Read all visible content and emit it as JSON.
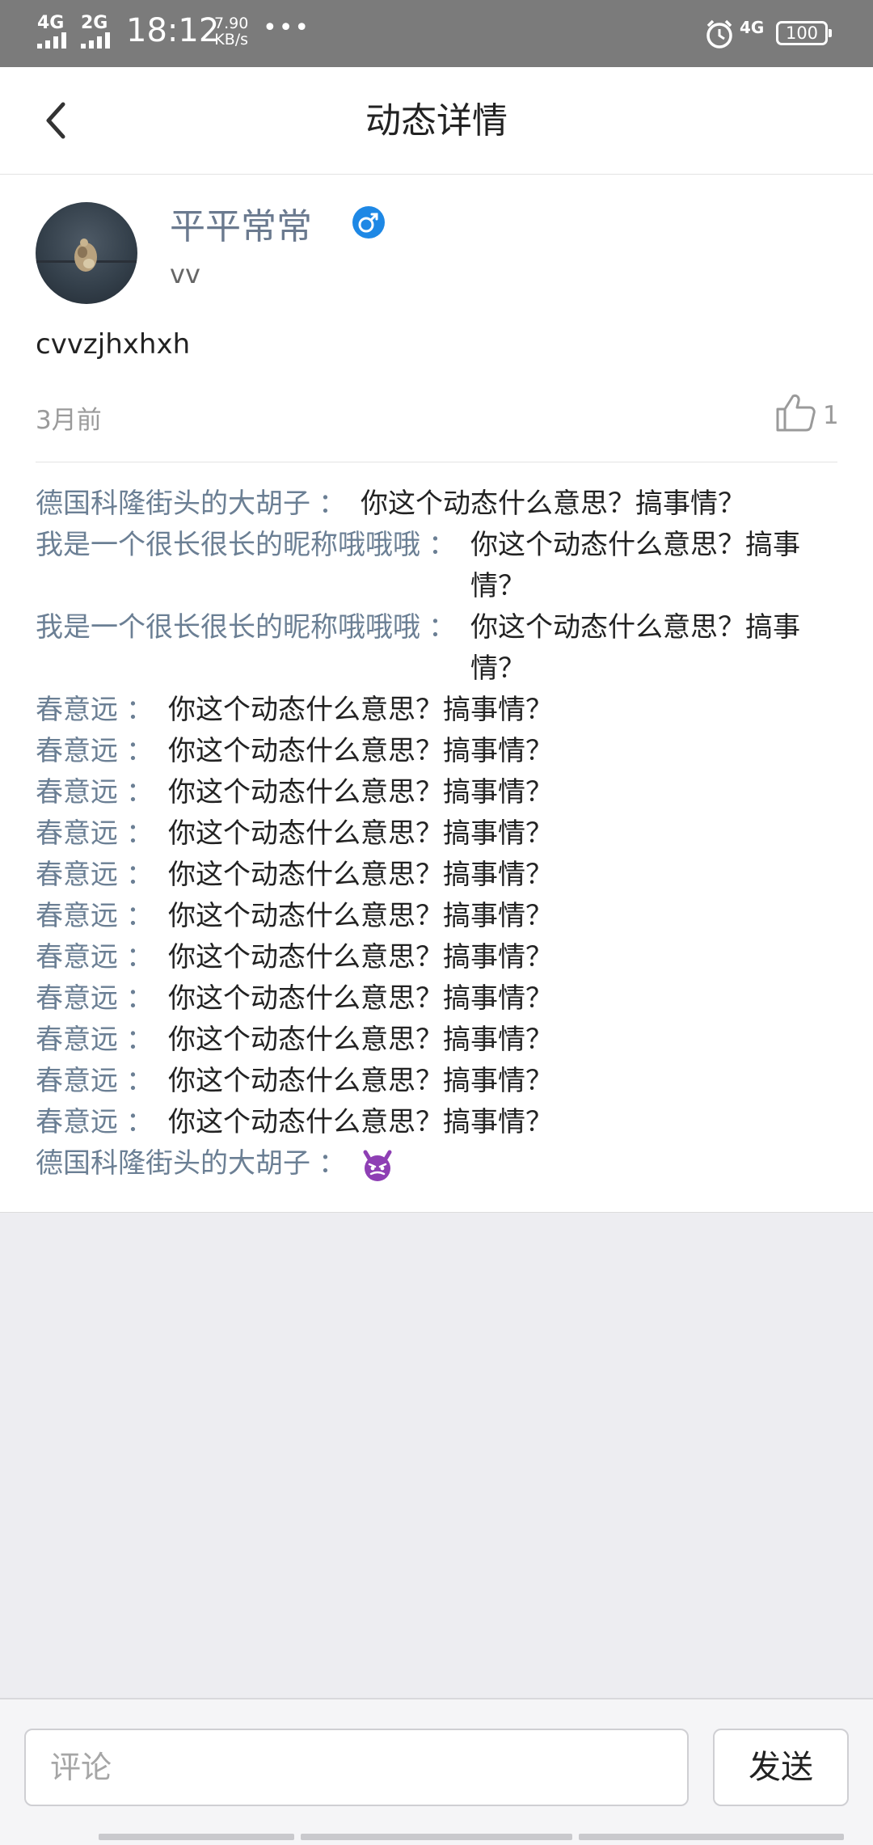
{
  "status_bar": {
    "network1": "4G",
    "network2": "2G",
    "time": "18:12",
    "speed_value": "7.90",
    "speed_unit": "KB/s",
    "more": "•••",
    "network3": "4G",
    "battery": "100"
  },
  "header": {
    "title": "动态详情",
    "back_icon": "chevron-left-icon"
  },
  "post": {
    "username": "平平常常",
    "gender_icon": "male-icon",
    "gender_color": "#1e88e5",
    "subname": "vv",
    "text": "cvvzjhxhxh",
    "time": "3月前",
    "like_count": "1"
  },
  "comments": [
    {
      "name": "德国科隆街头的大胡子",
      "colon": "：",
      "text": "你这个动态什么意思？搞事情？"
    },
    {
      "name": "我是一个很长很长的昵称哦哦哦",
      "colon": "：",
      "text": "你这个动态什么意思？搞事情？"
    },
    {
      "name": "我是一个很长很长的昵称哦哦哦",
      "colon": "：",
      "text": "你这个动态什么意思？搞事情？"
    },
    {
      "name": "春意远",
      "colon": "：",
      "text": "你这个动态什么意思？搞事情？"
    },
    {
      "name": "春意远",
      "colon": "：",
      "text": "你这个动态什么意思？搞事情？"
    },
    {
      "name": "春意远",
      "colon": "：",
      "text": "你这个动态什么意思？搞事情？"
    },
    {
      "name": "春意远",
      "colon": "：",
      "text": "你这个动态什么意思？搞事情？"
    },
    {
      "name": "春意远",
      "colon": "：",
      "text": "你这个动态什么意思？搞事情？"
    },
    {
      "name": "春意远",
      "colon": "：",
      "text": "你这个动态什么意思？搞事情？"
    },
    {
      "name": "春意远",
      "colon": "：",
      "text": "你这个动态什么意思？搞事情？"
    },
    {
      "name": "春意远",
      "colon": "：",
      "text": "你这个动态什么意思？搞事情？"
    },
    {
      "name": "春意远",
      "colon": "：",
      "text": "你这个动态什么意思？搞事情？"
    },
    {
      "name": "春意远",
      "colon": "：",
      "text": "你这个动态什么意思？搞事情？"
    },
    {
      "name": "春意远",
      "colon": "：",
      "text": "你这个动态什么意思？搞事情？"
    },
    {
      "name": "德国科隆街头的大胡子",
      "colon": "：",
      "emoji": "devil-emoji-icon"
    }
  ],
  "comment_bar": {
    "placeholder": "评论",
    "value": "",
    "send_label": "发送"
  }
}
